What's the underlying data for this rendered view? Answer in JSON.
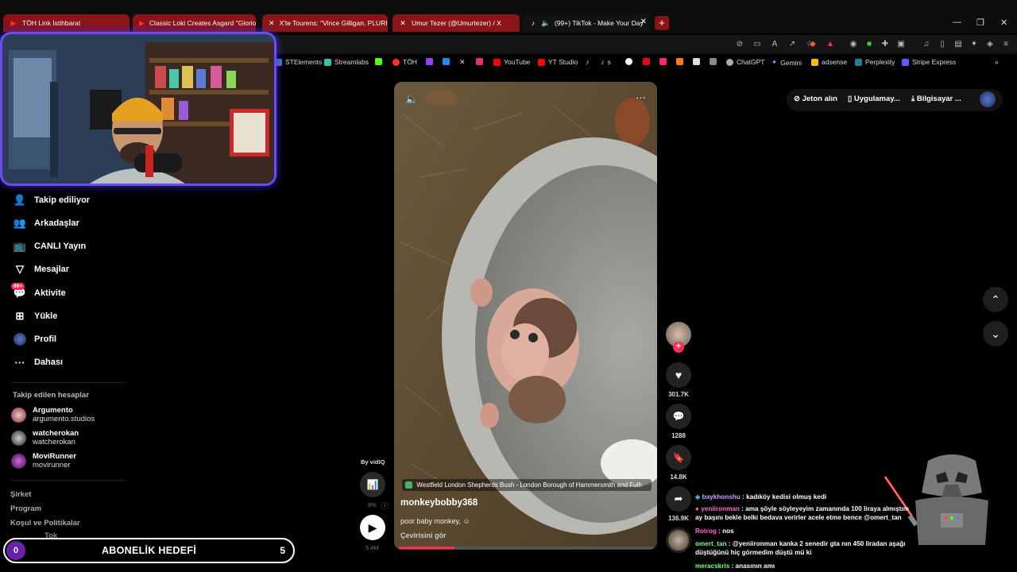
{
  "tabs": [
    {
      "label": "TÖH Link İstihbarat",
      "icon": "youtube-icon"
    },
    {
      "label": "Classic Loki Creates Asgard \"Glorious",
      "icon": "youtube-icon"
    },
    {
      "label": "X'te Tourens: \"Vince Gilligan, PLURIB",
      "icon": "x-icon"
    },
    {
      "label": "Umur Tezer (@Umurtezer) / X",
      "icon": "x-icon"
    },
    {
      "label": "(99+) TikTok - Make Your Day",
      "icon": "tiktok-icon"
    }
  ],
  "bookmarks": [
    "STElements",
    "Streamlabs",
    "TÖH",
    "YouTube",
    "YT Studio",
    "s",
    "ChatGPT",
    "Gemini",
    "adsense",
    "Perplexity",
    "Stripe Express"
  ],
  "sidebar": {
    "items": [
      {
        "label": "Takip ediliyor",
        "icon": "following-icon"
      },
      {
        "label": "Arkadaşlar",
        "icon": "friends-icon"
      },
      {
        "label": "CANLI Yayın",
        "icon": "live-icon"
      },
      {
        "label": "Mesajlar",
        "icon": "messages-icon"
      },
      {
        "label": "Aktivite",
        "icon": "activity-icon",
        "badge": "99+"
      },
      {
        "label": "Yükle",
        "icon": "upload-icon"
      },
      {
        "label": "Profil",
        "icon": "profile-icon"
      },
      {
        "label": "Dahası",
        "icon": "more-icon"
      }
    ],
    "followed_title": "Takip edilen hesaplar",
    "accounts": [
      {
        "name": "Argumento",
        "handle": "argumento.studios"
      },
      {
        "name": "watcherokan",
        "handle": "watcherokan"
      },
      {
        "name": "MoviRunner",
        "handle": "movirunner"
      }
    ],
    "footer": [
      "Şirket",
      "Program",
      "Koşul ve Politikalar"
    ],
    "footer_partial": "Tok"
  },
  "goal": {
    "current": "0",
    "label": "ABONELİK HEDEFİ",
    "target": "5"
  },
  "video": {
    "location": "Westfield London Shepherds Bush - London Borough of Hammersmith and Fulh",
    "author": "monkeybobby368",
    "caption": "poor baby monkey,",
    "caption_emoji": "☺",
    "translate": "Çevirisini gör"
  },
  "vidiq": {
    "by": "By vidIQ",
    "percent": "8%",
    "views": "5.4M"
  },
  "rail": {
    "likes": "301.7K",
    "comments": "1288",
    "saves": "14.8K",
    "shares": "136.9K"
  },
  "topright": {
    "coins": "Jeton alın",
    "app": "Uygulamay...",
    "computer": "Bilgisayar ..."
  },
  "chat": [
    {
      "user": "baykhonshu",
      "msg": "kadıköy kedisi olmuş kedi",
      "color": "#c8a2ff"
    },
    {
      "user": "yeniironman",
      "msg": "ama şöyle söyleyeyim zamanında 100 liraya almıştım ay başını bekle belki bedava verirler acele etme bence @omert_tan",
      "color": "#ff6ad5"
    },
    {
      "user": "Rotrog",
      "msg": "nos",
      "color": "#ff66cc"
    },
    {
      "user": "omert_tan",
      "msg": "@yeniironman kanka 2 senedir gta nın 450 liradan aşağı düştüğünü hiç görmedim düştü mü ki",
      "color": "#7cff7c"
    },
    {
      "user": "meracskris",
      "msg": "anasının amı",
      "color": "#7cff7c"
    }
  ],
  "colors": {
    "tab_red": "#8b1418",
    "accent": "#fe2c55",
    "webcam_border": "#6a4cf0"
  }
}
